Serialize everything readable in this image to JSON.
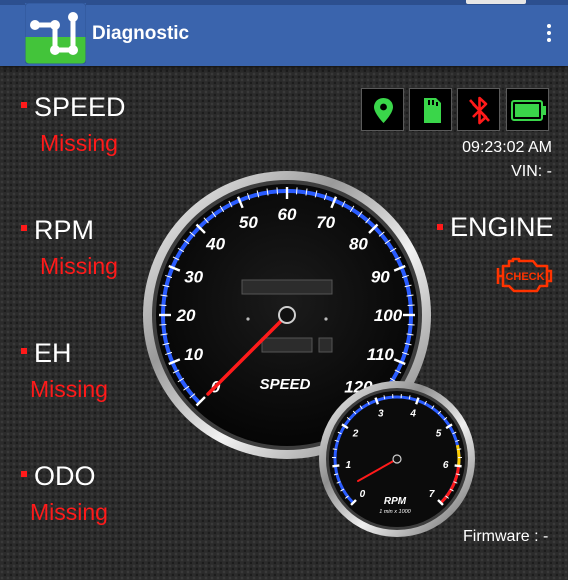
{
  "app": {
    "title": "Diagnostic"
  },
  "metrics": {
    "speed": {
      "label": "SPEED",
      "value": "Missing"
    },
    "rpm": {
      "label": "RPM",
      "value": "Missing"
    },
    "eh": {
      "label": "EH",
      "value": "Missing"
    },
    "odo": {
      "label": "ODO",
      "value": "Missing"
    }
  },
  "status": {
    "icons": [
      "location-pin-icon",
      "sd-card-icon",
      "bluetooth-off-icon",
      "battery-icon"
    ],
    "time": "09:23:02 AM",
    "vin": "VIN: -"
  },
  "engine": {
    "label": "ENGINE",
    "check_text": "CHECK",
    "check_color": "#ff3300"
  },
  "speed_gauge": {
    "label": "SPEED",
    "ticks": [
      "0",
      "10",
      "20",
      "30",
      "40",
      "50",
      "60",
      "70",
      "80",
      "90",
      "100",
      "110",
      "120"
    ],
    "value": 0
  },
  "rpm_gauge": {
    "label": "RPM",
    "sublabel": "1 min x 1000",
    "ticks": [
      "0",
      "1",
      "2",
      "3",
      "4",
      "5",
      "6",
      "7"
    ],
    "value": 0
  },
  "firmware": "Firmware : -",
  "colors": {
    "appbar": "#3a64ad",
    "accent_red": "#ff1a1a",
    "gauge_blue": "#2a5cff",
    "logo_green": "#43c43a"
  }
}
